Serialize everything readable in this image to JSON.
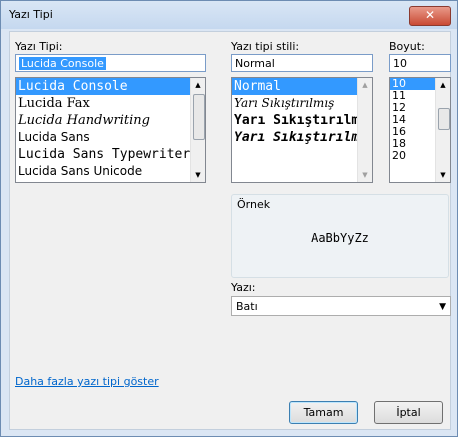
{
  "window": {
    "title": "Yazı Tipi",
    "close_label": "✕"
  },
  "font": {
    "label": "Yazı Tipi:",
    "value": "Lucida Console",
    "items": [
      "Lucida Console",
      "Lucida Fax",
      "Lucida Handwriting",
      "Lucida Sans",
      "Lucida Sans Typewriter",
      "Lucida Sans Unicode"
    ]
  },
  "style": {
    "label": "Yazı tipi stili:",
    "value": "Normal",
    "items": [
      "Normal",
      "Yarı Sıkıştırılmış",
      "Yarı Sıkıştırılmış",
      "Yarı Sıkıştırılmış"
    ]
  },
  "size": {
    "label": "Boyut:",
    "value": "10",
    "items": [
      "10",
      "11",
      "12",
      "14",
      "16",
      "18",
      "20"
    ]
  },
  "sample": {
    "label": "Örnek",
    "text": "AaBbYyZz"
  },
  "script": {
    "label": "Yazı:",
    "value": "Batı"
  },
  "more_fonts_link": "Daha fazla yazı tipi göster",
  "buttons": {
    "ok": "Tamam",
    "cancel": "İptal"
  },
  "colors": {
    "selection": "#3399ff",
    "link": "#0066cc"
  }
}
